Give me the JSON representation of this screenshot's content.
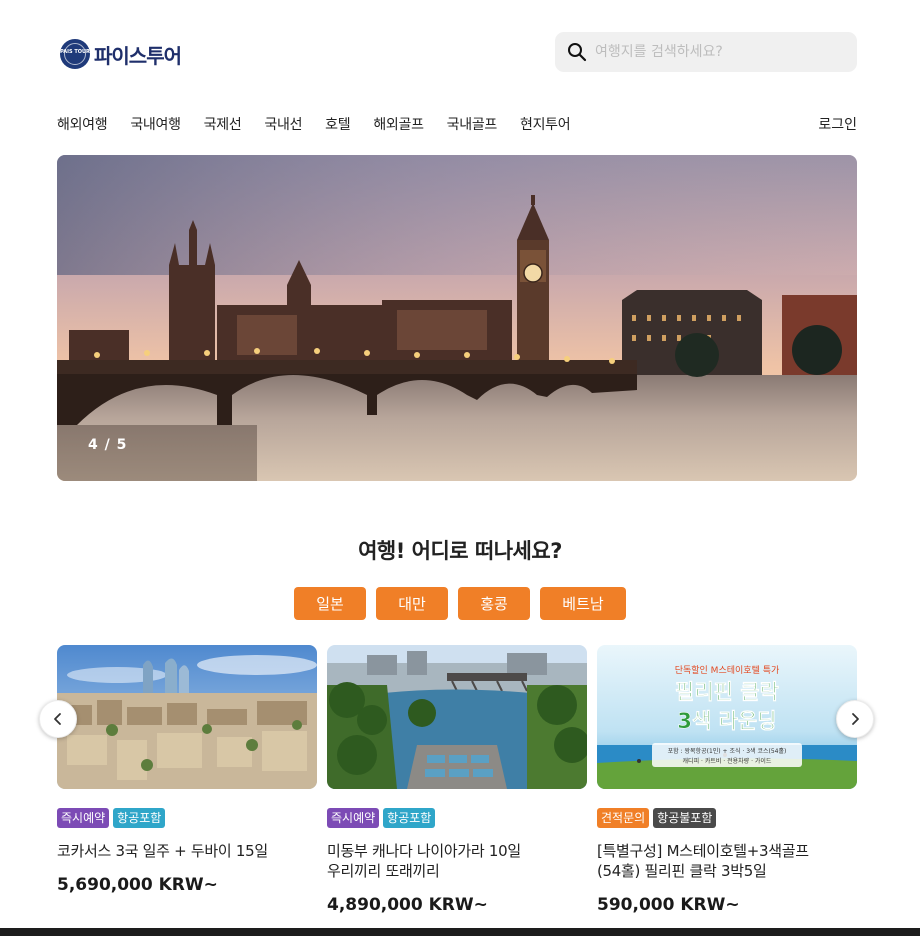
{
  "brand": {
    "logo_text": "파이스투어",
    "logo_mark_text": "PAIS TOUR"
  },
  "search": {
    "placeholder": "여행지를 검색하세요?"
  },
  "nav": {
    "items": [
      "해외여행",
      "국내여행",
      "국제선",
      "국내선",
      "호텔",
      "해외골프",
      "국내골프",
      "현지투어"
    ],
    "login": "로그인"
  },
  "hero": {
    "counter": "4 / 5"
  },
  "section": {
    "title": "여행! 어디로 떠나세요?"
  },
  "chips": [
    "일본",
    "대만",
    "홍콩",
    "베트남"
  ],
  "colors": {
    "accent": "#f07f27",
    "tag_instant": "#7c4bb5",
    "tag_flight": "#2fa6c9",
    "tag_quote": "#f07f27",
    "tag_noflight": "#4a4a4a",
    "brand": "#1f2f6b"
  },
  "products": [
    {
      "tags": [
        {
          "label": "즉시예약",
          "kind": "instant"
        },
        {
          "label": "항공포함",
          "kind": "flight"
        }
      ],
      "title_line1": "코카서스 3국 일주 + 두바이 15일",
      "title_line2": "",
      "price": "5,690,000 KRW~"
    },
    {
      "tags": [
        {
          "label": "즉시예약",
          "kind": "instant"
        },
        {
          "label": "항공포함",
          "kind": "flight"
        }
      ],
      "title_line1": "미동부 캐나다 나이아가라 10일",
      "title_line2": "우리끼리 또래끼리",
      "price": "4,890,000 KRW~"
    },
    {
      "tags": [
        {
          "label": "견적문의",
          "kind": "quote"
        },
        {
          "label": "항공불포함",
          "kind": "noflight"
        }
      ],
      "title_line1": "[특별구성] M스테이호텔+3색골프",
      "title_line2": "(54홀) 필리핀 클락 3박5일",
      "price": "590,000 KRW~",
      "banner": {
        "headline1": "필리핀 클락",
        "headline2": "3색 라운딩",
        "kicker": "단독할인 M스테이호텔 특가",
        "detail1": "포함 : 왕복항공(1인) + 조식 · 3색 코스(54홀)",
        "detail2": "캐디피 · 카트비 · 전용차량 · 가이드"
      }
    }
  ],
  "icons": {
    "search": "search-icon",
    "prev": "chevron-left-icon",
    "next": "chevron-right-icon",
    "logo": "globe-logo-icon"
  }
}
